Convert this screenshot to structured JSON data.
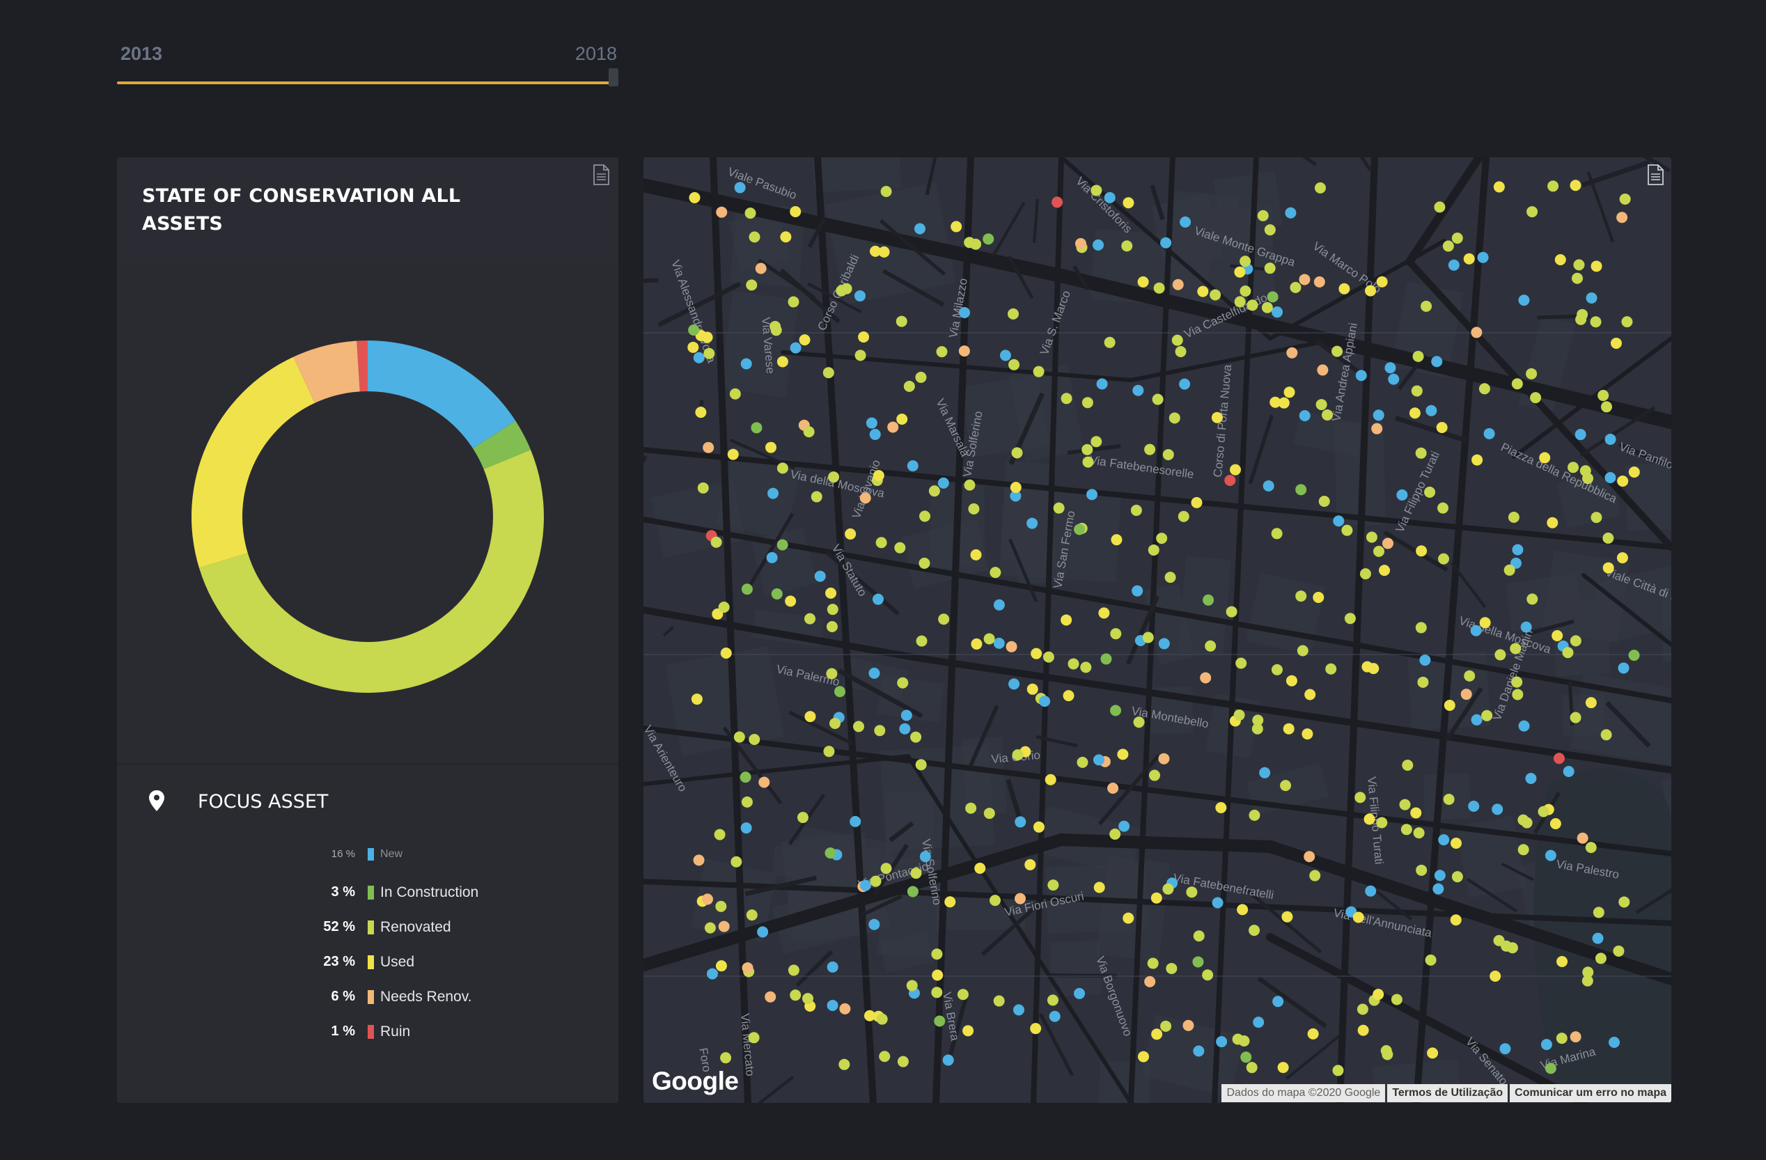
{
  "timeline": {
    "start_year": "2013",
    "end_year": "2018",
    "position": 1.0,
    "accent": "#e3a83a"
  },
  "left_panel": {
    "title": "STATE OF CONSERVATION ALL ASSETS",
    "focus_title": "FOCUS ASSET",
    "export_icon": "document-icon",
    "pin_icon": "map-pin-icon"
  },
  "chart_data": {
    "type": "pie",
    "donut": true,
    "categories": [
      "New",
      "In Construction",
      "Renovated",
      "Used",
      "Needs Renov.",
      "Ruin"
    ],
    "values": [
      16,
      3,
      52,
      23,
      6,
      1
    ],
    "colors": [
      "#4db1e3",
      "#82bd52",
      "#c8d84f",
      "#f0e24a",
      "#f3b779",
      "#e05454"
    ],
    "legend": [
      {
        "pct": "16 %",
        "label": "New",
        "color": "#4db1e3"
      },
      {
        "pct": "3 %",
        "label": "In Construction",
        "color": "#82bd52"
      },
      {
        "pct": "52 %",
        "label": "Renovated",
        "color": "#c8d84f"
      },
      {
        "pct": "23 %",
        "label": "Used",
        "color": "#f0e24a"
      },
      {
        "pct": "6 %",
        "label": "Needs Renov.",
        "color": "#f3b779"
      },
      {
        "pct": "1 %",
        "label": "Ruin",
        "color": "#e05454"
      }
    ]
  },
  "map": {
    "street_labels": [
      "Viale Pasubio",
      "Via Cristoforis",
      "Viale Monte Grappa",
      "Via Marco Polo",
      "Via Alessandro Volta",
      "Via Varese",
      "Corso Garibaldi",
      "Via Milazzo",
      "Via S. Marco",
      "Via Castelfidardo",
      "Via Marsala",
      "Via Solferino",
      "Via della Moscova",
      "Via Statuto",
      "Via Lovanio",
      "Via Fatebenesorelle",
      "Corso di Porta Nuova",
      "Via Andrea Appiani",
      "Piazza della Repubblica",
      "Viale Città di F",
      "Via Filippo Turati",
      "Via della Moscova",
      "Via San Fermo",
      "Via Palermo",
      "Via Montebello",
      "Via Gorio",
      "Via Solferino",
      "Via Pontaccio",
      "Via Fiori Oscuri",
      "Via Fatebenefratelli",
      "Via dell'Annunciata",
      "Via Brera",
      "Via Mercato",
      "Via Borgonuovo",
      "Via Senato",
      "Via Marina",
      "Via Daniele Manin",
      "Via Panfilo C",
      "Via Arienteuro",
      "Foro",
      "Via Filippo Turati",
      "Via Palestro"
    ],
    "logo": "Google",
    "attribution": [
      "Dados do mapa ©2020 Google",
      "Termos de Utilização",
      "Comunicar um erro no mapa"
    ],
    "export_icon": "document-icon"
  }
}
